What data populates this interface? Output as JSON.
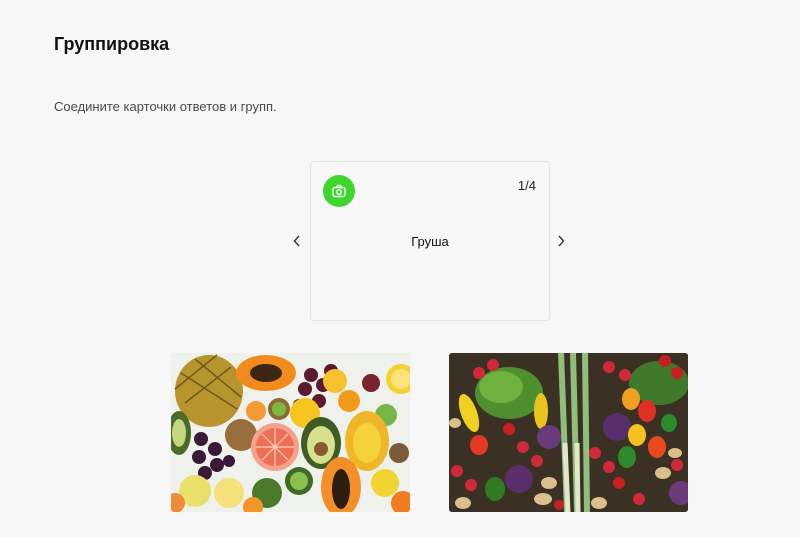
{
  "page": {
    "title": "Группировка",
    "instruction": "Соедините карточки ответов и групп."
  },
  "card": {
    "counter": "1/4",
    "text": "Груша",
    "icon": "camera-icon",
    "accent_color": "#3dd62d"
  },
  "navigation": {
    "prev_icon": "chevron-left-icon",
    "next_icon": "chevron-right-icon"
  },
  "groups": [
    {
      "image": "fruits-photo"
    },
    {
      "image": "vegetables-photo"
    }
  ]
}
